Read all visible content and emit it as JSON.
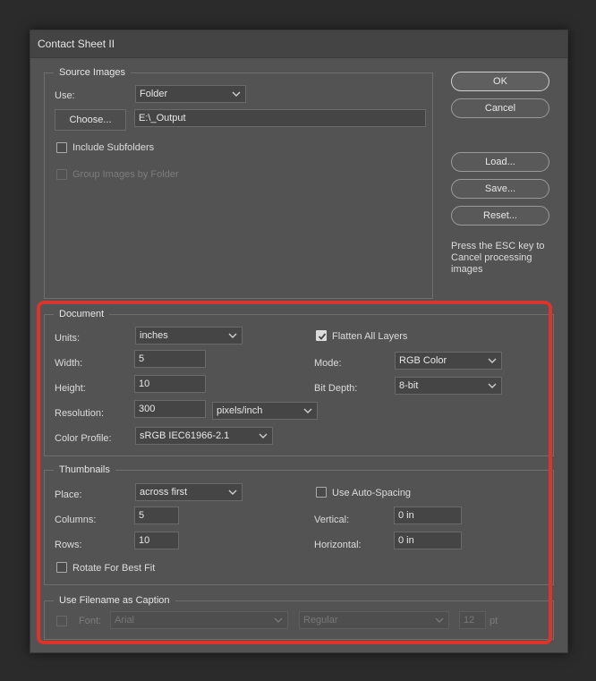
{
  "window": {
    "title": "Contact Sheet II"
  },
  "source_images": {
    "title": "Source Images",
    "use_label": "Use:",
    "use_value": "Folder",
    "choose_label": "Choose...",
    "path": "E:\\_Output",
    "include_subfolders": "Include Subfolders",
    "group_by_folder": "Group Images by Folder"
  },
  "buttons": {
    "ok": "OK",
    "cancel": "Cancel",
    "load": "Load...",
    "save": "Save...",
    "reset": "Reset..."
  },
  "esc_note": "Press the ESC key to Cancel processing images",
  "document": {
    "title": "Document",
    "units_label": "Units:",
    "units_value": "inches",
    "width_label": "Width:",
    "width_value": "5",
    "height_label": "Height:",
    "height_value": "10",
    "resolution_label": "Resolution:",
    "resolution_value": "300",
    "resolution_unit": "pixels/inch",
    "color_profile_label": "Color Profile:",
    "color_profile_value": "sRGB IEC61966-2.1",
    "flatten_label": "Flatten All Layers",
    "flatten_checked": true,
    "mode_label": "Mode:",
    "mode_value": "RGB Color",
    "bit_depth_label": "Bit Depth:",
    "bit_depth_value": "8-bit"
  },
  "thumbnails": {
    "title": "Thumbnails",
    "place_label": "Place:",
    "place_value": "across first",
    "columns_label": "Columns:",
    "columns_value": "5",
    "rows_label": "Rows:",
    "rows_value": "10",
    "rotate_label": "Rotate For Best Fit",
    "auto_spacing_label": "Use Auto-Spacing",
    "vertical_label": "Vertical:",
    "vertical_value": "0 in",
    "horizontal_label": "Horizontal:",
    "horizontal_value": "0 in"
  },
  "caption": {
    "title": "Use Filename as Caption",
    "font_label": "Font:",
    "font_value": "Arial",
    "style_value": "Regular",
    "size_value": "12",
    "size_unit": "pt"
  },
  "colors": {
    "highlight": "#d9352c",
    "dialog_bg": "#535353"
  }
}
